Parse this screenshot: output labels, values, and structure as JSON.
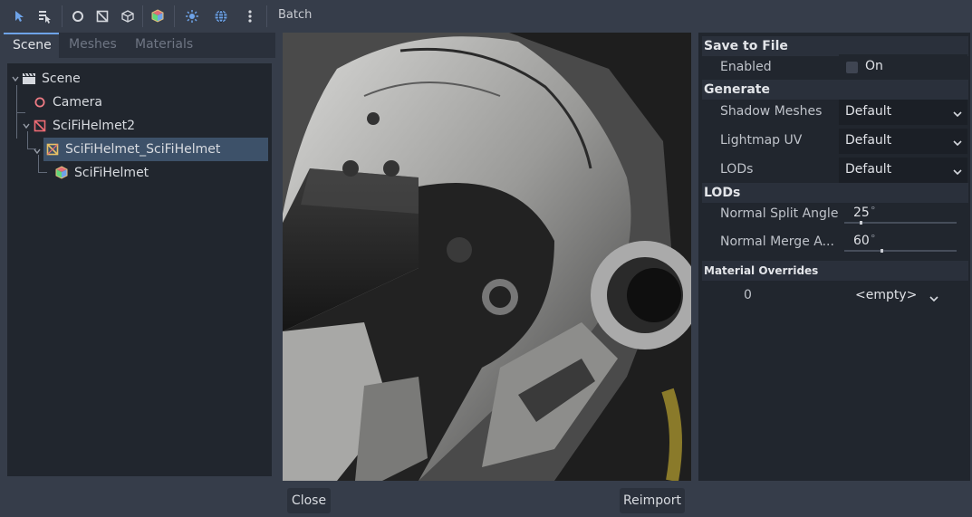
{
  "toolbar": {
    "batch_label": "Batch",
    "icons": [
      "select-arrow-icon",
      "list-select-icon",
      "circle-icon",
      "mesh-instance-icon",
      "box-icon",
      "color-cube-icon",
      "sun-icon",
      "globe-icon",
      "more-vertical-icon"
    ]
  },
  "tabs": [
    "Scene",
    "Meshes",
    "Materials"
  ],
  "tree": {
    "items": [
      {
        "label": "Scene",
        "icon": "clapperboard-icon"
      },
      {
        "label": "Camera",
        "icon": "camera-circle-icon"
      },
      {
        "label": "SciFiHelmet2",
        "icon": "node3d-icon"
      },
      {
        "label": "SciFiHelmet_SciFiHelmet",
        "icon": "mesh-node-icon",
        "selected": true
      },
      {
        "label": "SciFiHelmet",
        "icon": "mesh-cube-icon"
      }
    ]
  },
  "inspector": {
    "save_to_file": "Save to File",
    "enabled_label": "Enabled",
    "enabled_value": "On",
    "generate": "Generate",
    "shadow_meshes_label": "Shadow Meshes",
    "shadow_meshes_value": "Default",
    "lightmap_uv_label": "Lightmap UV",
    "lightmap_uv_value": "Default",
    "lods_label": "LODs",
    "lods_value": "Default",
    "lods_section": "LODs",
    "normal_split_label": "Normal Split Angle",
    "normal_split_value": "25",
    "normal_merge_label": "Normal Merge A...",
    "normal_merge_value": "60",
    "unit": "°",
    "material_overrides": "Material Overrides",
    "override_index": "0",
    "override_value": "<empty>"
  },
  "buttons": {
    "close": "Close",
    "reimport": "Reimport"
  },
  "colors": {
    "accent": "#6ea3e8",
    "selection": "#3d5169",
    "background": "#363d4a",
    "panel": "#21262e"
  }
}
